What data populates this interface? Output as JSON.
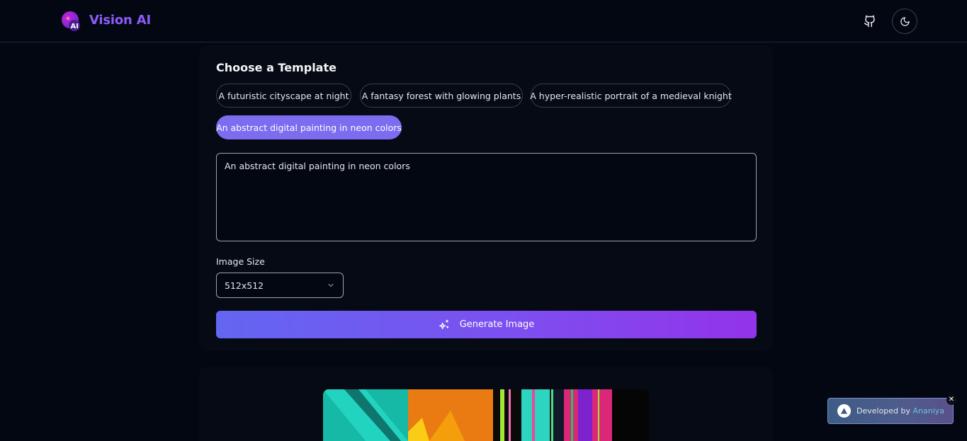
{
  "header": {
    "brand": "Vision AI",
    "logo_badge": "AI",
    "github_icon": "github-icon",
    "theme_icon": "moon-icon"
  },
  "templates": {
    "title": "Choose a Template",
    "chips": [
      {
        "label": "A futuristic cityscape at night",
        "active": false
      },
      {
        "label": "A fantasy forest with glowing plants",
        "active": false
      },
      {
        "label": "A hyper-realistic portrait of a medieval knight",
        "active": false
      },
      {
        "label": "An abstract digital painting in neon colors",
        "active": true
      }
    ]
  },
  "prompt": {
    "value": "An abstract digital painting in neon colors"
  },
  "image_size": {
    "label": "Image Size",
    "selected": "512x512"
  },
  "generate": {
    "label": "Generate Image",
    "icon": "sparkles-icon"
  },
  "toast": {
    "prefix": "Developed by",
    "author": "Ananiya",
    "close": "✕"
  },
  "colors": {
    "accent": "#8b5cf6",
    "chip_active": "#7c6cf0",
    "button_start": "#6366f1",
    "button_end": "#9333ea"
  }
}
